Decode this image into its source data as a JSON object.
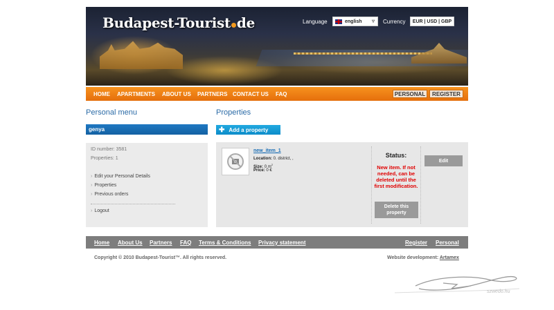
{
  "header": {
    "logo": "Budapest-Tourist",
    "logo_tld": "de",
    "language_label": "Language",
    "language_value": "english",
    "currency_label": "Currency",
    "currency_options": "EUR | USD | GBP"
  },
  "nav": {
    "items": [
      "HOME",
      "APARTMENTS",
      "ABOUT US",
      "PARTNERS",
      "CONTACT US",
      "FAQ"
    ],
    "personal": "PERSONAL",
    "register": "REGISTER"
  },
  "sidebar": {
    "title": "Personal menu",
    "username": "genya",
    "id_number": "ID number: 3581",
    "properties_count": "Properties: 1",
    "links": [
      "Edit your Personal Details",
      "Properties",
      "Previous orders"
    ],
    "logout": "Logout"
  },
  "main": {
    "title": "Properties",
    "add_button": "Add a property",
    "property": {
      "name": "new_item_1",
      "location_label": "Location:",
      "location_value": "0. district, ,",
      "size_label": "Size:",
      "size_value": "0 m",
      "size_sup": "2",
      "price_label": "Price:",
      "price_value": "0 €",
      "status_title": "Status:",
      "status_message": "New item. If not needed, can be deleted until the first modification.",
      "delete_button": "Delete this property",
      "edit_button": "Edit"
    }
  },
  "footer": {
    "links": [
      "Home",
      "About Us",
      "Partners",
      "FAQ",
      "Terms & Conditions",
      "Privacy statement"
    ],
    "register": "Register",
    "personal": "Personal",
    "copyright": "Copyright © 2010 Budapest-Tourist™. All rights reserved.",
    "webdev_label": "Website development:",
    "webdev_link": "Artamex"
  },
  "watermark": "szwedo.hu",
  "colors": {
    "nav_orange": "#f7921e",
    "blue_bar": "#1f78c2",
    "title_blue": "#2a6aa6",
    "status_red": "#e00000"
  }
}
